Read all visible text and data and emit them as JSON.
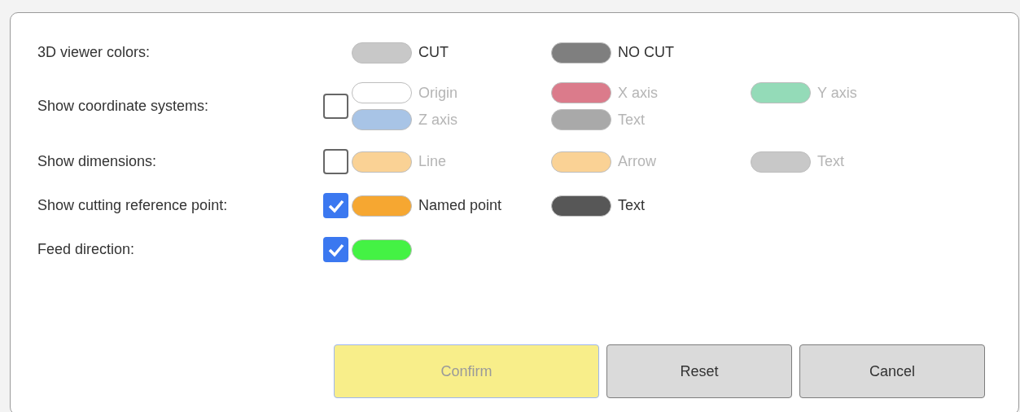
{
  "settings": [
    {
      "label": "3D viewer colors:",
      "items": [
        {
          "label": "CUT",
          "color": "#c8c8c8"
        },
        {
          "label": "NO CUT",
          "color": "#7f7f7f"
        }
      ]
    },
    {
      "label": "Show coordinate systems:",
      "checked": false,
      "items": [
        {
          "label": "Origin",
          "color": "#ffffff"
        },
        {
          "label": "X axis",
          "color": "#db7b8b"
        },
        {
          "label": "Y axis",
          "color": "#94dbb8"
        },
        {
          "label": "Z axis",
          "color": "#a8c4e6"
        },
        {
          "label": "Text",
          "color": "#a9a9a9"
        }
      ]
    },
    {
      "label": "Show dimensions:",
      "checked": false,
      "items": [
        {
          "label": "Line",
          "color": "#fad295"
        },
        {
          "label": "Arrow",
          "color": "#fad295"
        },
        {
          "label": "Text",
          "color": "#c8c8c8"
        }
      ]
    },
    {
      "label": "Show cutting reference point:",
      "checked": true,
      "items": [
        {
          "label": "Named point",
          "color": "#f6a731"
        },
        {
          "label": "Text",
          "color": "#575757"
        }
      ]
    },
    {
      "label": "Feed direction:",
      "checked": true,
      "items": [
        {
          "color": "#44f244"
        }
      ]
    }
  ],
  "buttons": [
    {
      "label": "Confirm",
      "kind": "primary",
      "disabled": true
    },
    {
      "label": "Reset",
      "kind": "secondary",
      "disabled": false
    },
    {
      "label": "Cancel",
      "kind": "secondary",
      "disabled": false
    }
  ]
}
